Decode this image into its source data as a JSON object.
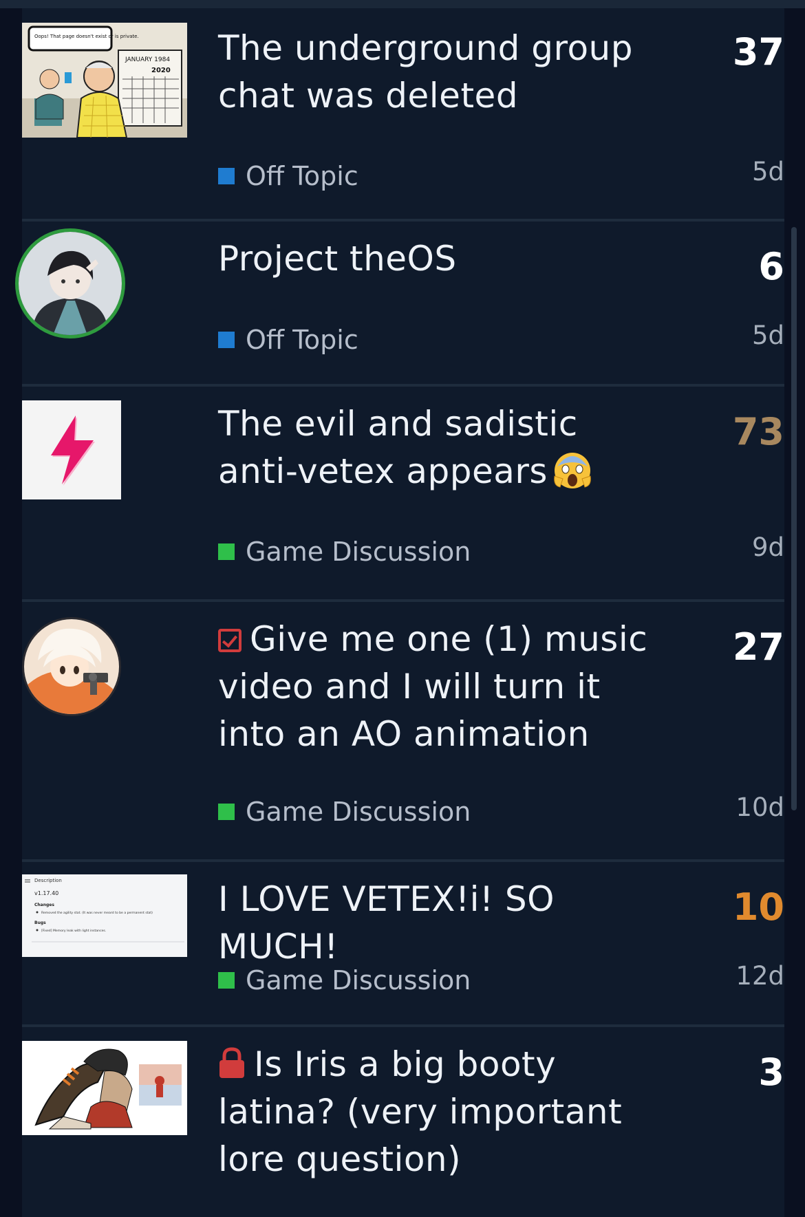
{
  "colors": {
    "background": "#0f1a2b",
    "count_white": "#ffffff",
    "count_hot": "#e08a2e",
    "count_warm": "#a8885f",
    "off_topic": "#1f7cd0",
    "game_discussion": "#2fbf4a"
  },
  "topics": [
    {
      "title": "The underground group chat was deleted",
      "category": "Off Topic",
      "replies": "37",
      "age": "5d",
      "thumbnail": "comic-thumbnail",
      "comic": {
        "bubble": "Oops! That page doesn't exist or is private.",
        "calendar_month": "JANUARY 1984",
        "calendar_year": "2020"
      }
    },
    {
      "title": "Project theOS",
      "category": "Off Topic",
      "replies": "6",
      "age": "5d",
      "thumbnail": "user-avatar"
    },
    {
      "title": "The evil and sadistic anti-vetex appears",
      "title_emoji": "screaming-face-emoji",
      "category": "Game Discussion",
      "replies": "73",
      "age": "9d",
      "thumbnail": "lightning-icon"
    },
    {
      "title": "Give me one (1) music video and I will turn it into an AO animation",
      "status_icon": "checkbox-icon",
      "category": "Game Discussion",
      "replies": "27",
      "age": "10d",
      "thumbnail": "user-avatar"
    },
    {
      "title": "I LOVE VETEX!i! SO MUCH!",
      "category": "Game Discussion",
      "replies": "10",
      "age": "12d",
      "thumbnail": "patch-notes-thumbnail",
      "notes": {
        "heading": "Description",
        "version": "v1.17.40",
        "changes_label": "Changes",
        "change_item": "Removed the agility stat. (It was never meant to be a permanent stat)",
        "bugs_label": "Bugs",
        "bug_item": "[Fixed] Memory leak with light instances."
      }
    },
    {
      "title": "Is Iris a big booty latina? (very important lore question)",
      "status_icon": "lock-icon",
      "replies": "3",
      "thumbnail": "character-art-thumbnail"
    }
  ]
}
